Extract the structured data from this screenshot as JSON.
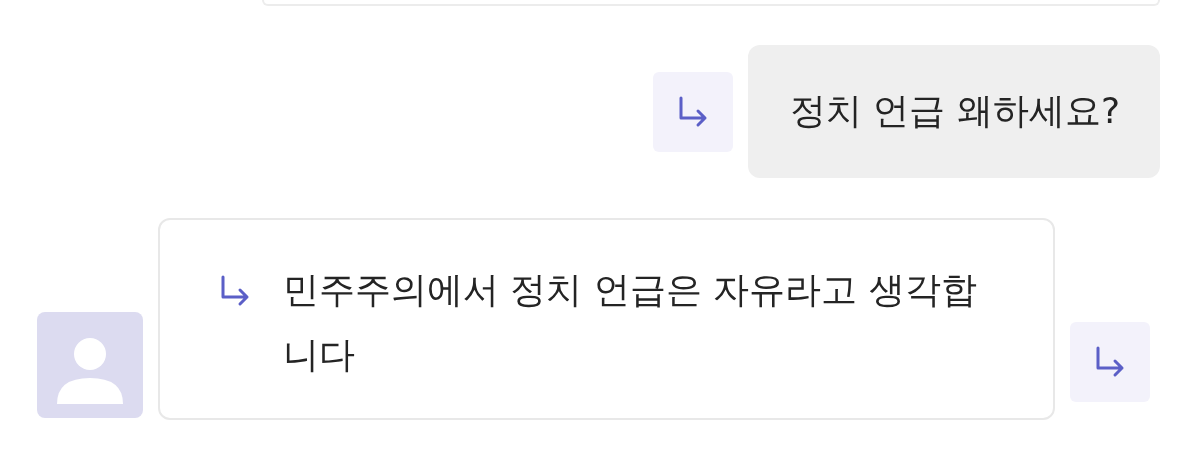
{
  "messages": [
    {
      "kind": "sent",
      "text": "정치 언급 왜하세요?"
    },
    {
      "kind": "received",
      "text": "민주주의에서 정치 언급은 자유라고 생각합니다"
    }
  ]
}
